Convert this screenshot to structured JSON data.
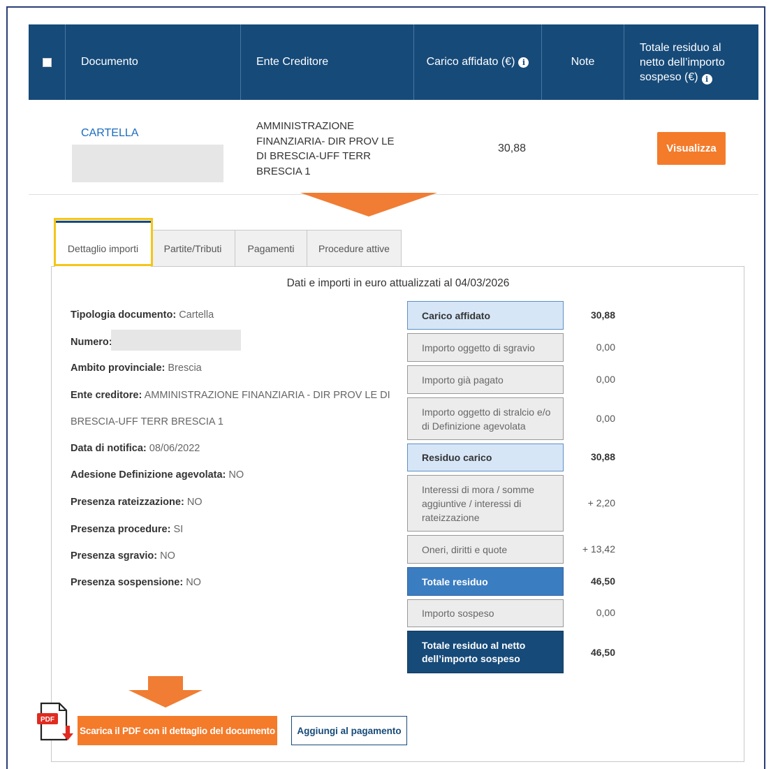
{
  "table": {
    "headers": {
      "documento": "Documento",
      "ente": "Ente Creditore",
      "carico": "Carico affidato (€)",
      "note": "Note",
      "totale_lines": [
        "Totale residuo al",
        "netto dell’importo",
        "sospeso (€)"
      ]
    },
    "row": {
      "documento": "CARTELLA",
      "ente_lines": [
        "AMMINISTRAZIONE",
        "FINANZIARIA- DIR PROV LE",
        "DI BRESCIA-UFF TERR",
        "BRESCIA 1"
      ],
      "carico": "30,88",
      "action": "Visualizza"
    }
  },
  "tabs": [
    "Dettaglio importi",
    "Partite/Tributi",
    "Pagamenti",
    "Procedure attive"
  ],
  "detail": {
    "title": "Dati e importi in euro attualizzati al 04/03/2026",
    "fields": [
      {
        "label": "Tipologia documento:",
        "value": "Cartella"
      },
      {
        "label": "Numero:",
        "value": ""
      },
      {
        "label": "Ambito provinciale:",
        "value": "Brescia"
      },
      {
        "label": "Ente creditore:",
        "value": "AMMINISTRAZIONE FINANZIARIA - DIR PROV LE DI"
      },
      {
        "label": "",
        "value": "BRESCIA-UFF TERR BRESCIA 1"
      },
      {
        "label": "Data di notifica:",
        "value": "08/06/2022"
      },
      {
        "label": "Adesione Definizione agevolata:",
        "value": "NO"
      },
      {
        "label": "Presenza rateizzazione:",
        "value": "NO"
      },
      {
        "label": "Presenza procedure:",
        "value": "SI"
      },
      {
        "label": "Presenza sgravio:",
        "value": "NO"
      },
      {
        "label": "Presenza sospensione:",
        "value": "NO"
      }
    ],
    "amounts": [
      {
        "label": "Carico affidato",
        "value": "30,88"
      },
      {
        "label": "Importo oggetto di sgravio",
        "value": "0,00"
      },
      {
        "label": "Importo già pagato",
        "value": "0,00"
      },
      {
        "label": "Importo oggetto di stralcio e/o di Definizione agevolata",
        "value": "0,00"
      },
      {
        "label": "Residuo carico",
        "value": "30,88"
      },
      {
        "label": "Interessi di mora / somme aggiuntive / interessi di rateizzazione",
        "value": "+ 2,20"
      },
      {
        "label": "Oneri, diritti e quote",
        "value": "+ 13,42"
      },
      {
        "label": "Totale residuo",
        "value": "46,50"
      },
      {
        "label": "Importo sospeso",
        "value": "0,00"
      },
      {
        "label": "Totale residuo al netto dell’importo sospeso",
        "value": "46,50"
      }
    ]
  },
  "actions": {
    "pdf_badge": "PDF",
    "download_pdf": "Scarica il PDF con il dettaglio del documento",
    "add_payment": "Aggiungi al pagamento"
  },
  "colors": {
    "header_blue": "#164a79",
    "accent_orange": "#f47b2a",
    "tab_highlight": "#f5c518",
    "light_blue": "#d6e6f7",
    "mid_blue": "#3b7dc1"
  }
}
